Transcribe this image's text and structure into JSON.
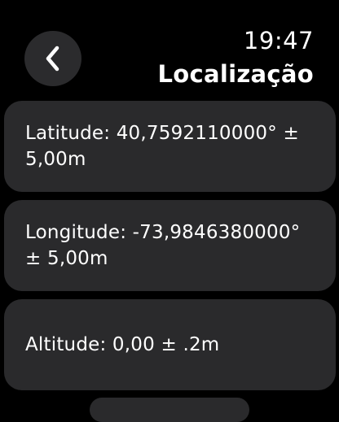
{
  "header": {
    "time": "19:47",
    "title": "Localização",
    "back_icon": "chevron-left-icon"
  },
  "cards": {
    "latitude": "Latitude: 40,7592110000° ± 5,00m",
    "longitude": "Longitude: -73,9846380000° ± 5,00m",
    "altitude": "Altitude: 0,00 ± .2m"
  },
  "colors": {
    "background": "#000000",
    "card": "#2a2a2c",
    "button": "#2b2b2d",
    "text": "#ffffff"
  }
}
